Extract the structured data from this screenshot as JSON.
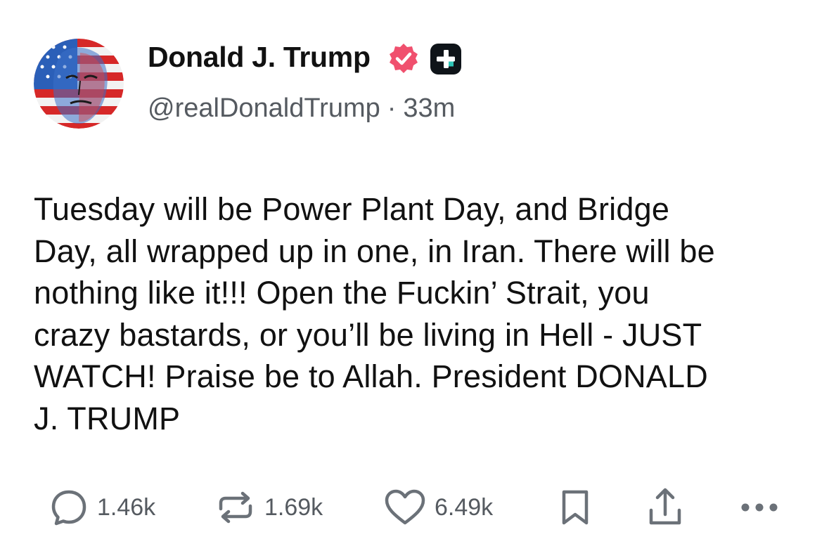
{
  "author": {
    "display_name": "Donald J. Trump",
    "handle": "@realDonaldTrump",
    "separator": "·",
    "time_ago": "33m",
    "verified_icon": "verified-badge-icon",
    "subscription_icon": "plus-badge-icon"
  },
  "post": {
    "text": "Tuesday will be Power Plant Day, and Bridge\nDay, all wrapped up in one, in Iran. There will be\nnothing like it!!! Open the Fuckin’ Strait, you\ncrazy bastards, or you’ll be living in Hell - JUST\nWATCH! Praise be to Allah. President DONALD\nJ. TRUMP"
  },
  "actions": {
    "replies": "1.46k",
    "reposts": "1.69k",
    "likes": "6.49k"
  },
  "colors": {
    "verified": "#f0506e",
    "badge_bg": "#0f1419",
    "badge_accent": "#2ec4b6",
    "secondary_text": "#555a60",
    "icon_gray": "#6b7178"
  }
}
